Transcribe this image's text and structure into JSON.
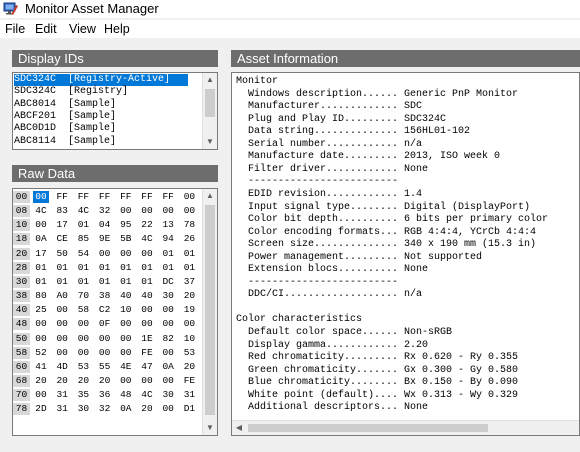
{
  "window": {
    "title": "Monitor Asset Manager"
  },
  "menu": [
    "File",
    "Edit",
    "View",
    "Help"
  ],
  "display_ids": {
    "header": "Display IDs",
    "items": [
      {
        "id": "SDC324C",
        "tag": "[Registry-Active]",
        "selected": true
      },
      {
        "id": "SDC324C",
        "tag": "[Registry]",
        "selected": false
      },
      {
        "id": "ABC8014",
        "tag": "[Sample]",
        "selected": false
      },
      {
        "id": "ABCF201",
        "tag": "[Sample]",
        "selected": false
      },
      {
        "id": "ABC0D1D",
        "tag": "[Sample]",
        "selected": false
      },
      {
        "id": "ABC8114",
        "tag": "[Sample]",
        "selected": false
      }
    ]
  },
  "raw_data": {
    "header": "Raw Data",
    "selected_cell": {
      "row": 0,
      "col": 0
    },
    "rows": [
      {
        "addr": "00",
        "bytes": [
          "00",
          "FF",
          "FF",
          "FF",
          "FF",
          "FF",
          "FF",
          "00"
        ]
      },
      {
        "addr": "08",
        "bytes": [
          "4C",
          "83",
          "4C",
          "32",
          "00",
          "00",
          "00",
          "00"
        ]
      },
      {
        "addr": "10",
        "bytes": [
          "00",
          "17",
          "01",
          "04",
          "95",
          "22",
          "13",
          "78"
        ]
      },
      {
        "addr": "18",
        "bytes": [
          "0A",
          "CE",
          "85",
          "9E",
          "5B",
          "4C",
          "94",
          "26"
        ]
      },
      {
        "addr": "20",
        "bytes": [
          "17",
          "50",
          "54",
          "00",
          "00",
          "00",
          "01",
          "01"
        ]
      },
      {
        "addr": "28",
        "bytes": [
          "01",
          "01",
          "01",
          "01",
          "01",
          "01",
          "01",
          "01"
        ]
      },
      {
        "addr": "30",
        "bytes": [
          "01",
          "01",
          "01",
          "01",
          "01",
          "01",
          "DC",
          "37"
        ]
      },
      {
        "addr": "38",
        "bytes": [
          "80",
          "A0",
          "70",
          "38",
          "40",
          "40",
          "30",
          "20"
        ]
      },
      {
        "addr": "40",
        "bytes": [
          "25",
          "00",
          "58",
          "C2",
          "10",
          "00",
          "00",
          "19"
        ]
      },
      {
        "addr": "48",
        "bytes": [
          "00",
          "00",
          "00",
          "0F",
          "00",
          "00",
          "00",
          "00"
        ]
      },
      {
        "addr": "50",
        "bytes": [
          "00",
          "00",
          "00",
          "00",
          "00",
          "1E",
          "82",
          "10"
        ]
      },
      {
        "addr": "58",
        "bytes": [
          "52",
          "00",
          "00",
          "00",
          "00",
          "FE",
          "00",
          "53"
        ]
      },
      {
        "addr": "60",
        "bytes": [
          "41",
          "4D",
          "53",
          "55",
          "4E",
          "47",
          "0A",
          "20"
        ]
      },
      {
        "addr": "68",
        "bytes": [
          "20",
          "20",
          "20",
          "20",
          "00",
          "00",
          "00",
          "FE"
        ]
      },
      {
        "addr": "70",
        "bytes": [
          "00",
          "31",
          "35",
          "36",
          "48",
          "4C",
          "30",
          "31"
        ]
      },
      {
        "addr": "78",
        "bytes": [
          "2D",
          "31",
          "30",
          "32",
          "0A",
          "20",
          "00",
          "D1"
        ]
      }
    ]
  },
  "asset_info": {
    "header": "Asset Information",
    "lines": [
      "Monitor",
      "  Windows description...... Generic PnP Monitor",
      "  Manufacturer............. SDC",
      "  Plug and Play ID......... SDC324C",
      "  Data string.............. 156HL01-102",
      "  Serial number............ n/a",
      "  Manufacture date......... 2013, ISO week 0",
      "  Filter driver............ None",
      "  -------------------------",
      "  EDID revision............ 1.4",
      "  Input signal type........ Digital (DisplayPort)",
      "  Color bit depth.......... 6 bits per primary color",
      "  Color encoding formats... RGB 4:4:4, YCrCb 4:4:4",
      "  Screen size.............. 340 x 190 mm (15.3 in)",
      "  Power management......... Not supported",
      "  Extension blocs.......... None",
      "  -------------------------",
      "  DDC/CI................... n/a",
      "",
      "Color characteristics",
      "  Default color space...... Non-sRGB",
      "  Display gamma............ 2.20",
      "  Red chromaticity......... Rx 0.620 - Ry 0.355",
      "  Green chromaticity....... Gx 0.300 - Gy 0.580",
      "  Blue chromaticity........ Bx 0.150 - By 0.090",
      "  White point (default).... Wx 0.313 - Wy 0.329",
      "  Additional descriptors... None"
    ]
  }
}
